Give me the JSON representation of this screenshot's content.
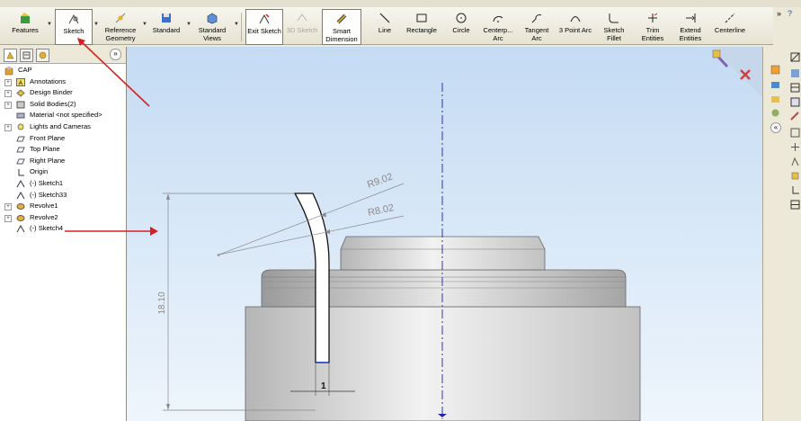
{
  "toolbar": {
    "features": "Features",
    "sketch": "Sketch",
    "reference_geometry": [
      "Reference",
      "Geometry"
    ],
    "standard": "Standard",
    "standard_views": [
      "Standard",
      "Views"
    ],
    "exit_sketch": "Exit Sketch",
    "sketch_3d": "3D Sketch",
    "smart_dimension": [
      "Smart",
      "Dimension"
    ],
    "line": "Line",
    "rectangle": "Rectangle",
    "circle": "Circle",
    "centerpoint_arc": [
      "Centerp...",
      "Arc"
    ],
    "tangent_arc": [
      "Tangent",
      "Arc"
    ],
    "three_point_arc": "3 Point Arc",
    "sketch_fillet": [
      "Sketch",
      "Fillet"
    ],
    "trim_entities": [
      "Trim",
      "Entities"
    ],
    "extend_entities": [
      "Extend",
      "Entities"
    ],
    "centerline": "Centerline"
  },
  "feature_tree": {
    "root": "CAP",
    "items": [
      {
        "label": "Annotations",
        "icon": "annotations-icon",
        "expandable": true
      },
      {
        "label": "Design Binder",
        "icon": "design-binder-icon",
        "expandable": true
      },
      {
        "label": "Solid Bodies(2)",
        "icon": "solid-bodies-icon",
        "expandable": true
      },
      {
        "label": "Material <not specified>",
        "icon": "material-icon",
        "expandable": false
      },
      {
        "label": "Lights and Cameras",
        "icon": "lights-icon",
        "expandable": true
      },
      {
        "label": "Front Plane",
        "icon": "plane-icon",
        "expandable": false
      },
      {
        "label": "Top Plane",
        "icon": "plane-icon",
        "expandable": false
      },
      {
        "label": "Right Plane",
        "icon": "plane-icon",
        "expandable": false
      },
      {
        "label": "Origin",
        "icon": "origin-icon",
        "expandable": false
      },
      {
        "label": "(-) Sketch1",
        "icon": "sketch-icon",
        "expandable": false
      },
      {
        "label": "(-) Sketch33",
        "icon": "sketch-icon",
        "expandable": false
      },
      {
        "label": "Revolve1",
        "icon": "revolve-icon",
        "expandable": true
      },
      {
        "label": "Revolve2",
        "icon": "revolve-icon",
        "expandable": true
      },
      {
        "label": "(-) Sketch4",
        "icon": "sketch-icon",
        "expandable": false
      }
    ]
  },
  "viewport": {
    "dimensions": {
      "outer_radius": "R9.02",
      "inner_radius": "R8.02",
      "height": "18.10",
      "thickness": "1"
    }
  },
  "colors": {
    "annotation_arrow": "#d42020",
    "centerline": "#2020b0",
    "dimension": "#8a8a8a",
    "part_gray": "#c9c9c9",
    "viewport_top": "#c4dbf3"
  }
}
